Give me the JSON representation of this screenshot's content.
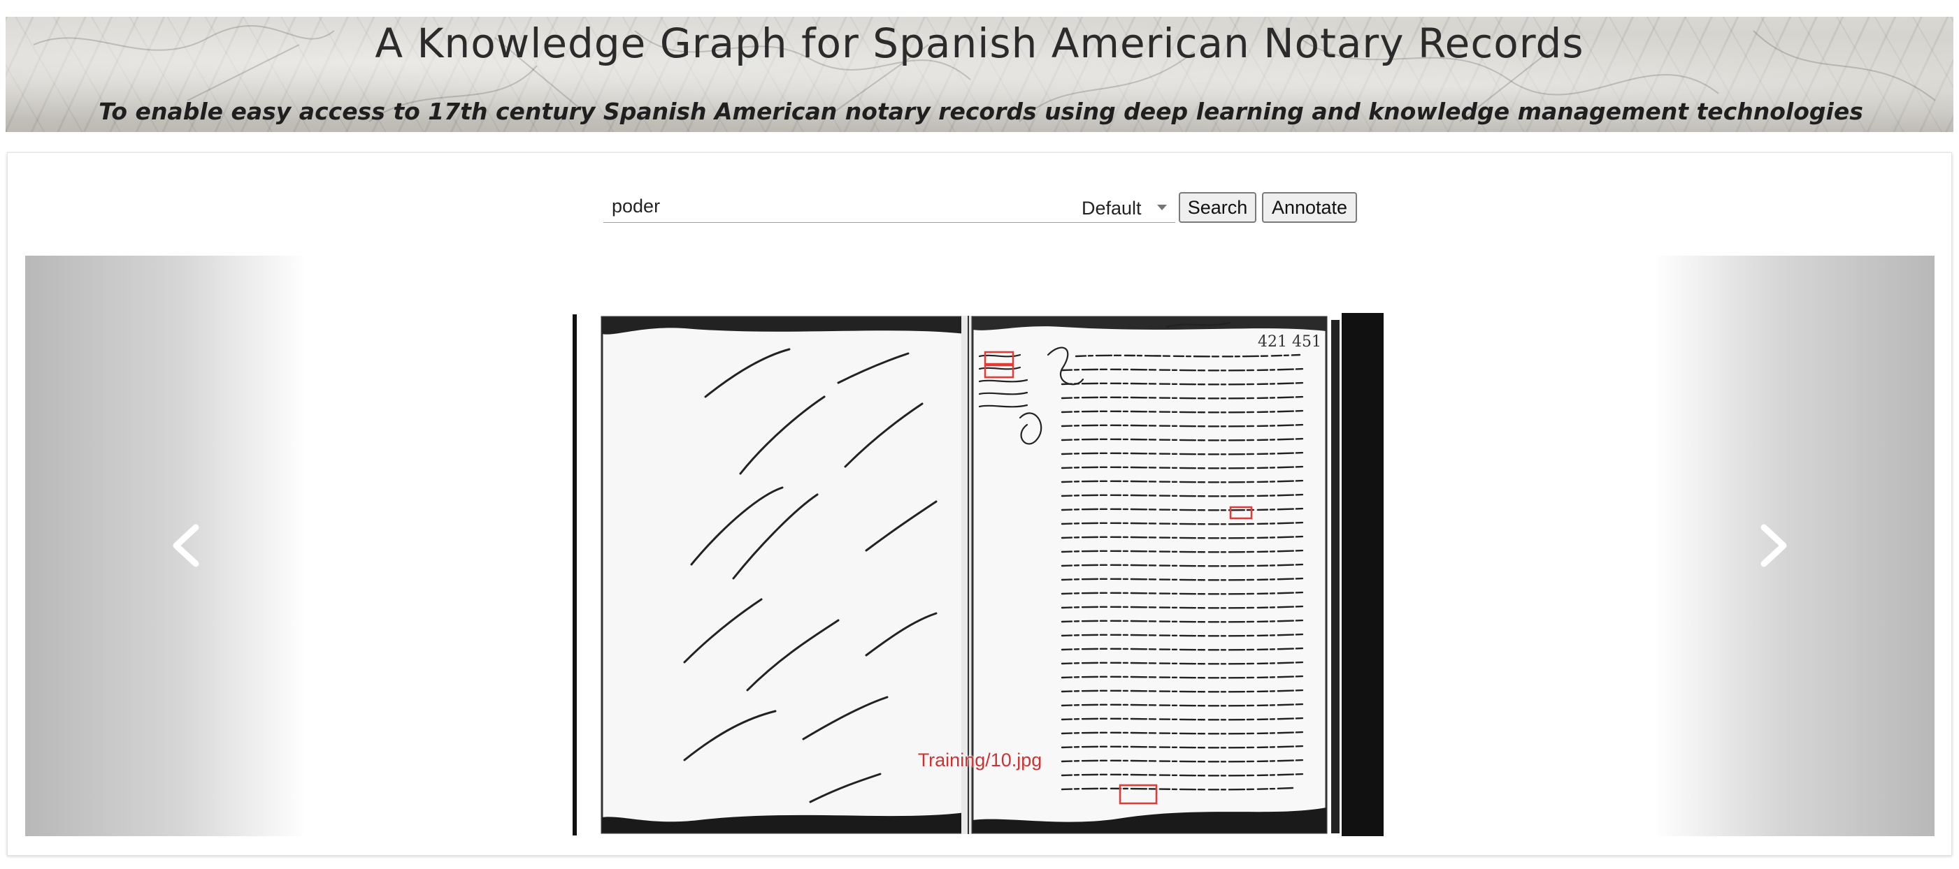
{
  "header": {
    "title": "A Knowledge Graph for Spanish American Notary Records",
    "subtitle": "To enable easy access to 17th century Spanish American notary records using deep learning and  knowledge management technologies"
  },
  "search": {
    "value": "poder",
    "mode_selected": "Default",
    "search_label": "Search",
    "annotate_label": "Annotate"
  },
  "carousel": {
    "caption": "Training/10.jpg",
    "prev_icon": "chevron-left-icon",
    "next_icon": "chevron-right-icon"
  },
  "colors": {
    "caption": "#d32f2f",
    "highlight_box": "#e53935"
  }
}
